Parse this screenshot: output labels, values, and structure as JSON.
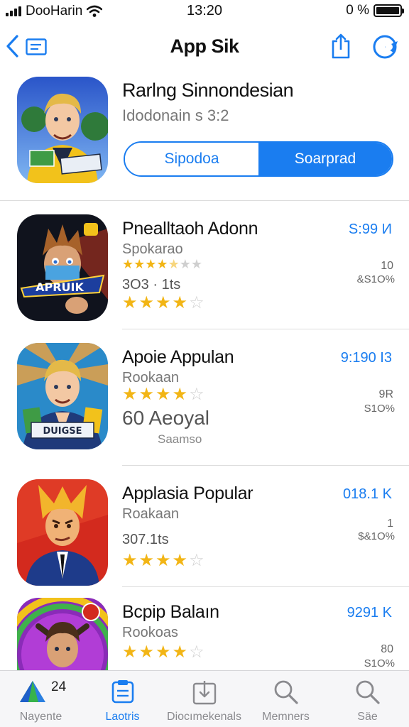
{
  "status_bar": {
    "carrier": "DooHarin",
    "time": "13:20",
    "battery": "0 %"
  },
  "nav": {
    "title": "App Sik"
  },
  "featured": {
    "name": "Rarlng Sinnondesian",
    "subtitle": "Idodonain s 3:2",
    "segment_left": "Sipodoa",
    "segment_right": "Soarprad"
  },
  "apps": [
    {
      "name": "Pnealltaoh Adonn",
      "subtitle": "Spokarao",
      "price": "S:99 И",
      "meta": "3O3 · 1ts",
      "stat1": "10",
      "stat2": "&S1O%",
      "rating_small": 4.5,
      "rating_big": 4,
      "icon_text": "APRUIK"
    },
    {
      "name": "Apoie Appulan",
      "subtitle": "Rookaan",
      "price": "9:190 I3",
      "meta": "60 Aeoyal",
      "extra": "Saamso",
      "stat1": "9R",
      "stat2": "S1O%",
      "rating_big": 4,
      "icon_text": "DUIGSE"
    },
    {
      "name": "Applasia Popular",
      "subtitle": "Roakaan",
      "price": "018.1 K",
      "meta": "307.1ts",
      "stat1": "1",
      "stat2": "$&1O%",
      "rating_big": 4
    },
    {
      "name": "Bcpip Balaın",
      "subtitle": "Rookoas",
      "price": "9291 K",
      "stat1": "80",
      "stat2": "S1O%",
      "rating_big": 4
    }
  ],
  "tabs": [
    {
      "label": "Nayente",
      "badge": "24",
      "icon": "prism-icon"
    },
    {
      "label": "Laotris",
      "icon": "clipboard-icon"
    },
    {
      "label": "Diocımekenals",
      "icon": "download-icon"
    },
    {
      "label": "Memners",
      "icon": "search-icon"
    },
    {
      "label": "Säe",
      "icon": "search-icon"
    }
  ],
  "colors": {
    "accent": "#1a7df0",
    "star": "#f2b515"
  }
}
